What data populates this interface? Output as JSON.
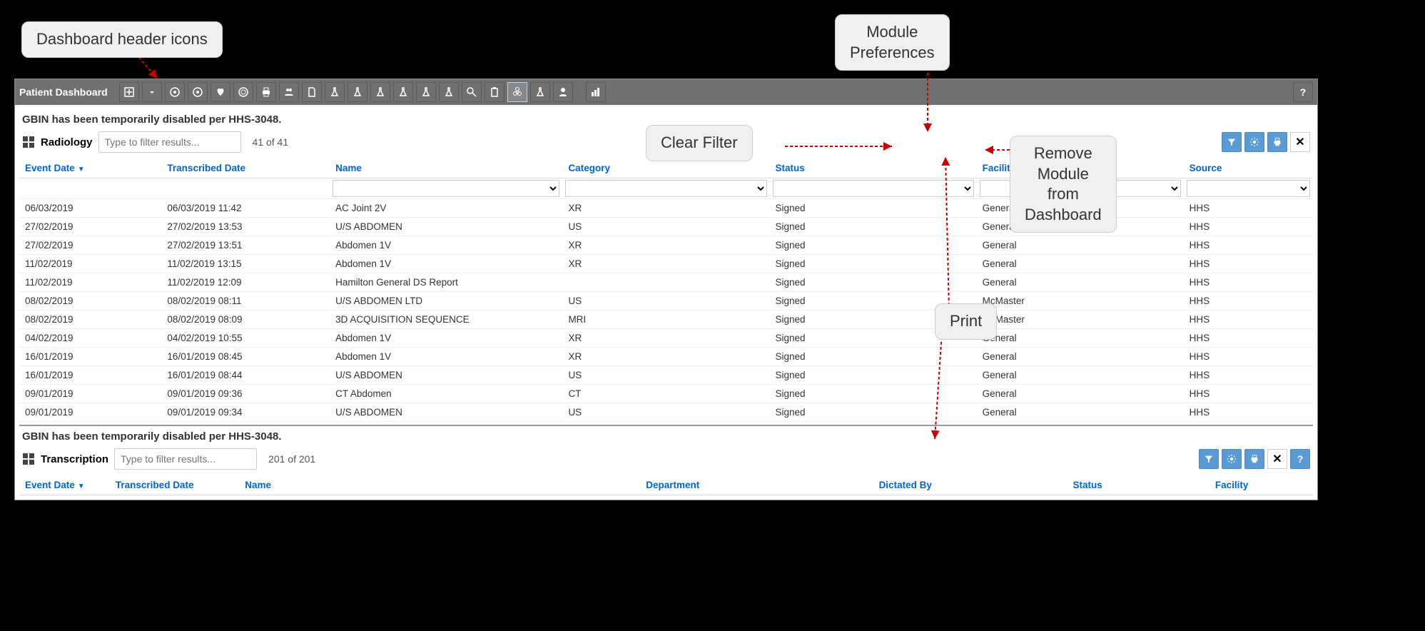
{
  "callouts": {
    "header_icons": "Dashboard header icons",
    "module_prefs": "Module\nPreferences",
    "clear_filter": "Clear Filter",
    "remove_module": "Remove\nModule\nfrom\nDashboard",
    "print": "Print"
  },
  "toolbar": {
    "title": "Patient Dashboard",
    "help_label": "?"
  },
  "notice": "GBIN has been temporarily disabled per HHS-3048.",
  "radiology": {
    "title": "Radiology",
    "filter_placeholder": "Type to filter results...",
    "count": "41 of 41",
    "columns": {
      "event_date": "Event Date",
      "transcribed_date": "Transcribed Date",
      "name": "Name",
      "category": "Category",
      "status": "Status",
      "facility": "Facility",
      "source": "Source"
    },
    "rows": [
      {
        "event_date": "06/03/2019",
        "transcribed": "06/03/2019 11:42",
        "name": "AC Joint 2V",
        "category": "XR",
        "status": "Signed",
        "facility": "General",
        "source": "HHS"
      },
      {
        "event_date": "27/02/2019",
        "transcribed": "27/02/2019 13:53",
        "name": "U/S ABDOMEN",
        "category": "US",
        "status": "Signed",
        "facility": "General",
        "source": "HHS"
      },
      {
        "event_date": "27/02/2019",
        "transcribed": "27/02/2019 13:51",
        "name": "Abdomen 1V",
        "category": "XR",
        "status": "Signed",
        "facility": "General",
        "source": "HHS"
      },
      {
        "event_date": "11/02/2019",
        "transcribed": "11/02/2019 13:15",
        "name": "Abdomen 1V",
        "category": "XR",
        "status": "Signed",
        "facility": "General",
        "source": "HHS"
      },
      {
        "event_date": "11/02/2019",
        "transcribed": "11/02/2019 12:09",
        "name": "Hamilton General DS Report",
        "category": "",
        "status": "Signed",
        "facility": "General",
        "source": "HHS"
      },
      {
        "event_date": "08/02/2019",
        "transcribed": "08/02/2019 08:11",
        "name": "U/S ABDOMEN LTD",
        "category": "US",
        "status": "Signed",
        "facility": "McMaster",
        "source": "HHS"
      },
      {
        "event_date": "08/02/2019",
        "transcribed": "08/02/2019 08:09",
        "name": "3D ACQUISITION SEQUENCE",
        "category": "MRI",
        "status": "Signed",
        "facility": "McMaster",
        "source": "HHS"
      },
      {
        "event_date": "04/02/2019",
        "transcribed": "04/02/2019 10:55",
        "name": "Abdomen 1V",
        "category": "XR",
        "status": "Signed",
        "facility": "General",
        "source": "HHS"
      },
      {
        "event_date": "16/01/2019",
        "transcribed": "16/01/2019 08:45",
        "name": "Abdomen 1V",
        "category": "XR",
        "status": "Signed",
        "facility": "General",
        "source": "HHS"
      },
      {
        "event_date": "16/01/2019",
        "transcribed": "16/01/2019 08:44",
        "name": "U/S ABDOMEN",
        "category": "US",
        "status": "Signed",
        "facility": "General",
        "source": "HHS"
      },
      {
        "event_date": "09/01/2019",
        "transcribed": "09/01/2019 09:36",
        "name": "CT Abdomen",
        "category": "CT",
        "status": "Signed",
        "facility": "General",
        "source": "HHS"
      },
      {
        "event_date": "09/01/2019",
        "transcribed": "09/01/2019 09:34",
        "name": "U/S ABDOMEN",
        "category": "US",
        "status": "Signed",
        "facility": "General",
        "source": "HHS"
      }
    ]
  },
  "transcription": {
    "title": "Transcription",
    "filter_placeholder": "Type to filter results...",
    "count": "201 of 201",
    "columns": {
      "event_date": "Event Date",
      "transcribed_date": "Transcribed Date",
      "name": "Name",
      "department": "Department",
      "dictated_by": "Dictated By",
      "status": "Status",
      "facility": "Facility"
    }
  }
}
